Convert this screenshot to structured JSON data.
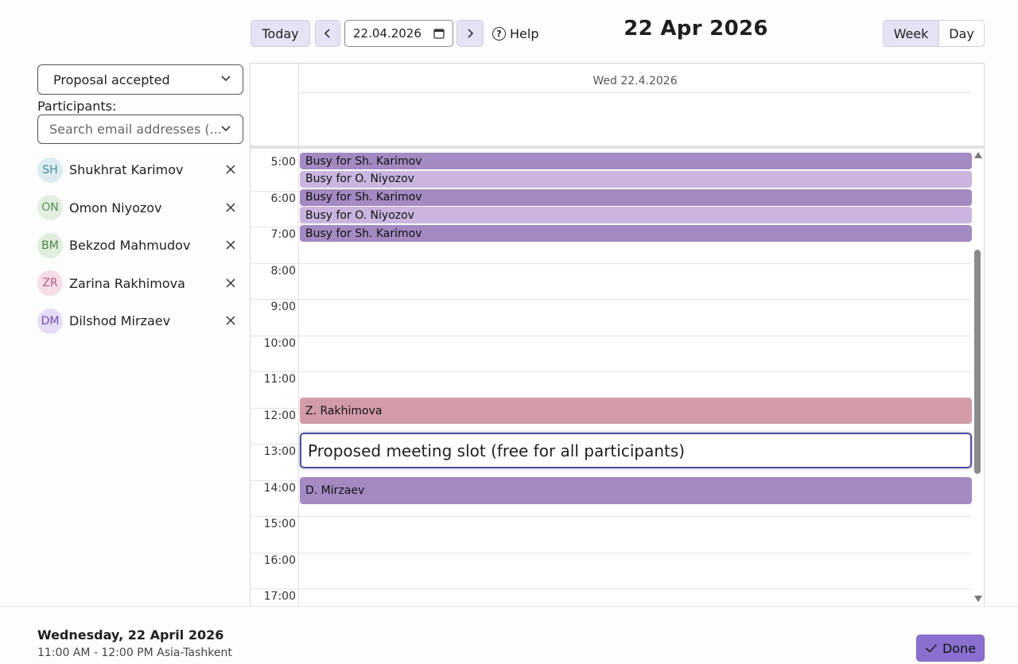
{
  "toolbar": {
    "today_label": "Today",
    "date_value": "22.04.2026",
    "help_label": "Help",
    "title": "22 Apr 2026",
    "view_week": "Week",
    "view_day": "Day",
    "active_view": "Week"
  },
  "sidebar": {
    "status_select": "Proposal accepted",
    "participants_label": "Participants:",
    "search_placeholder": "Search email addresses (...",
    "participants": [
      {
        "initials": "SH",
        "name": "Shukhrat Karimov",
        "avatar_bg": "#dcecf1",
        "avatar_fg": "#4a8aa0"
      },
      {
        "initials": "ON",
        "name": "Omon Niyozov",
        "avatar_bg": "#e2efe0",
        "avatar_fg": "#5b8f55"
      },
      {
        "initials": "BM",
        "name": "Bekzod Mahmudov",
        "avatar_bg": "#dfeedd",
        "avatar_fg": "#55804d"
      },
      {
        "initials": "ZR",
        "name": "Zarina Rakhimova",
        "avatar_bg": "#f6dde8",
        "avatar_fg": "#b15a80"
      },
      {
        "initials": "DM",
        "name": "Dilshod Mirzaev",
        "avatar_bg": "#e6dcf5",
        "avatar_fg": "#7650b4"
      }
    ]
  },
  "calendar": {
    "day_header": "Wed 22.4.2026",
    "hours": [
      "5:00",
      "6:00",
      "7:00",
      "8:00",
      "9:00",
      "10:00",
      "11:00",
      "12:00",
      "13:00",
      "14:00",
      "15:00",
      "16:00",
      "17:00"
    ],
    "busy_events": [
      {
        "label": "Busy for Sh. Karimov",
        "style": "dark"
      },
      {
        "label": "Busy for O. Niyozov",
        "style": "light"
      },
      {
        "label": "Busy for Sh. Karimov",
        "style": "dark"
      },
      {
        "label": "Busy for O. Niyozov",
        "style": "light"
      },
      {
        "label": "Busy for Sh. Karimov",
        "style": "dark"
      }
    ],
    "event_zr": "Z. Rakhimova",
    "proposal": "Proposed meeting slot (free for all participants)",
    "event_dm": "D. Mirzaev"
  },
  "footer": {
    "date": "Wednesday, 22 April 2026",
    "time": "11:00 AM - 12:00 PM Asia-Tashkent",
    "done_label": "Done"
  },
  "colors": {
    "accent": "#8b6fcf",
    "event_dark": "#a48ac2",
    "event_light": "#c9b5de",
    "event_pink": "#d39ba9",
    "proposal_border": "#4a4d9e"
  }
}
